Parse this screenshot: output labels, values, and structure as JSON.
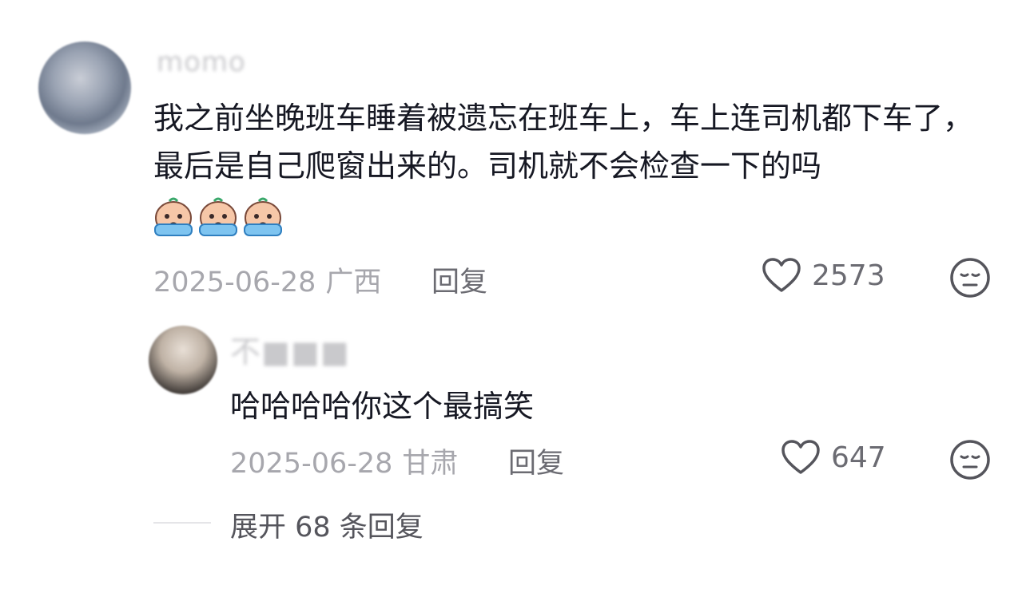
{
  "comment": {
    "username": "momo",
    "text": "我之前坐晚班车睡着被遗忘在班车上，车上连司机都下车了，最后是自己爬窗出来的。司机就不会检查一下的吗",
    "emoji_count": 3,
    "emoji_name": "crying-face-emoji",
    "date": "2025-06-28",
    "location": "广西",
    "reply_label": "回复",
    "likes": "2573"
  },
  "reply": {
    "username": "不■■■",
    "text": "哈哈哈哈你这个最搞笑",
    "date": "2025-06-28",
    "location": "甘肃",
    "reply_label": "回复",
    "likes": "647"
  },
  "expand_replies_label": "展开 68 条回复",
  "icons": {
    "like": "heart-outline-icon",
    "dislike": "meh-face-icon"
  },
  "colors": {
    "text_primary": "#161823",
    "text_secondary": "#a7a7ad",
    "action": "#6b6b72"
  }
}
